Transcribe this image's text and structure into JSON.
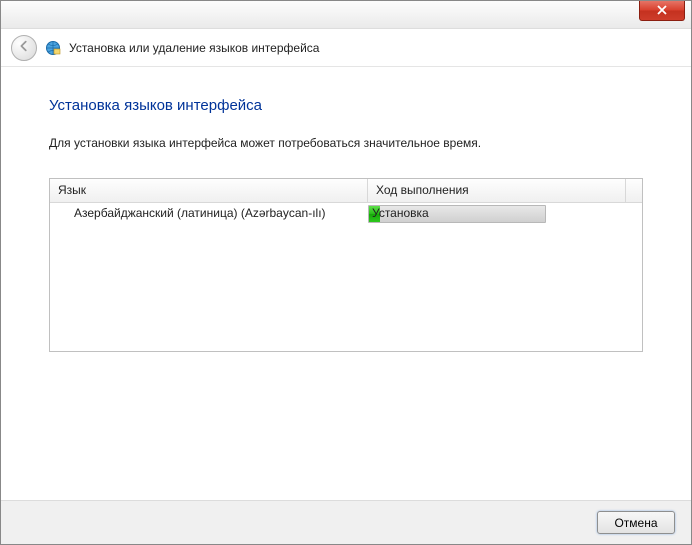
{
  "header": {
    "title": "Установка или удаление языков интерфейса"
  },
  "page": {
    "title": "Установка языков интерфейса",
    "description": "Для установки языка интерфейса может потребоваться значительное время."
  },
  "table": {
    "columns": {
      "language": "Язык",
      "progress": "Ход выполнения"
    },
    "rows": [
      {
        "language": "Азербайджанский (латиница) (Azərbaycan-ılı)",
        "status": "Установка",
        "percent": 6
      }
    ]
  },
  "footer": {
    "cancel": "Отмена"
  }
}
